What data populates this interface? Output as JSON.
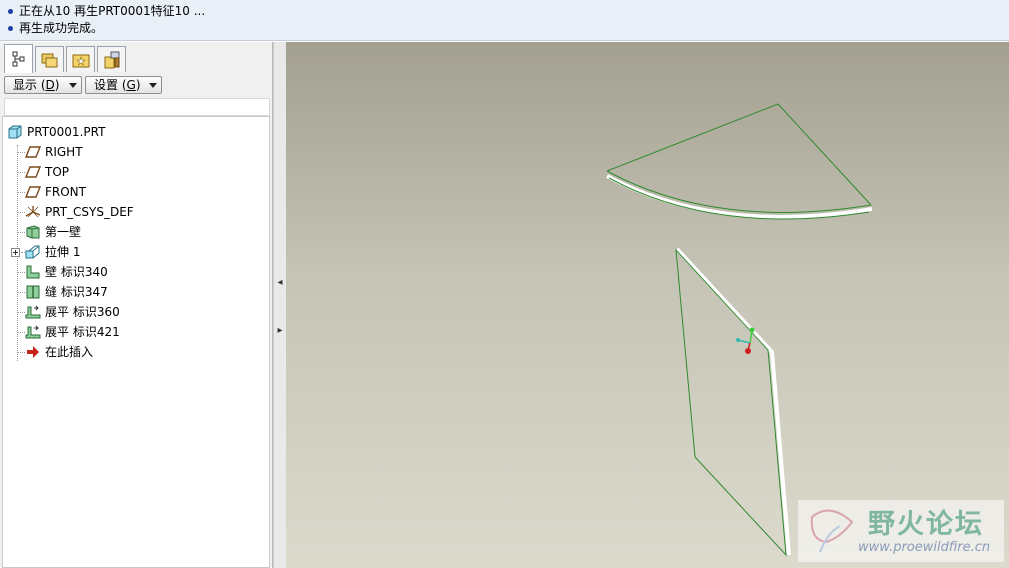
{
  "messages": [
    "正在从10 再生PRT0001特征10 ...",
    "再生成功完成。"
  ],
  "tabs": [
    {
      "name": "model-tree-tab",
      "icon": "tree-icon"
    },
    {
      "name": "folder-browser-tab",
      "icon": "folders-icon"
    },
    {
      "name": "favorites-tab",
      "icon": "favorites-folder-icon"
    },
    {
      "name": "connections-tab",
      "icon": "connections-icon"
    }
  ],
  "toolbar": {
    "show_label": "显示 (",
    "show_key": "D",
    "show_tail": ")",
    "settings_label": "设置 (",
    "settings_key": "G",
    "settings_tail": ")"
  },
  "tree": {
    "root": "PRT0001.PRT",
    "items": [
      {
        "label": "RIGHT",
        "icon": "datum-plane-icon"
      },
      {
        "label": "TOP",
        "icon": "datum-plane-icon"
      },
      {
        "label": "FRONT",
        "icon": "datum-plane-icon"
      },
      {
        "label": "PRT_CSYS_DEF",
        "icon": "csys-icon"
      },
      {
        "label": "第一壁",
        "icon": "first-wall-icon"
      },
      {
        "label": "拉伸 1",
        "icon": "extrude-icon"
      },
      {
        "label": "壁 标识340",
        "icon": "wall-icon"
      },
      {
        "label": "缝 标识347",
        "icon": "rip-icon"
      },
      {
        "label": "展平 标识360",
        "icon": "unbend-icon"
      },
      {
        "label": "展平 标识421",
        "icon": "unbend-icon"
      },
      {
        "label": "在此插入",
        "icon": "insert-here-arrow-icon"
      }
    ]
  },
  "watermark": {
    "title": "野火论坛",
    "url": "www.proewildfire.cn"
  },
  "colors": {
    "edge": "#2f8a2f",
    "highlight": "#ffffff",
    "csys_x": "#31b9b0",
    "csys_y": "#3ccc3c",
    "csys_origin": "#cc1f1f",
    "bullet": "#1a3fa6"
  }
}
